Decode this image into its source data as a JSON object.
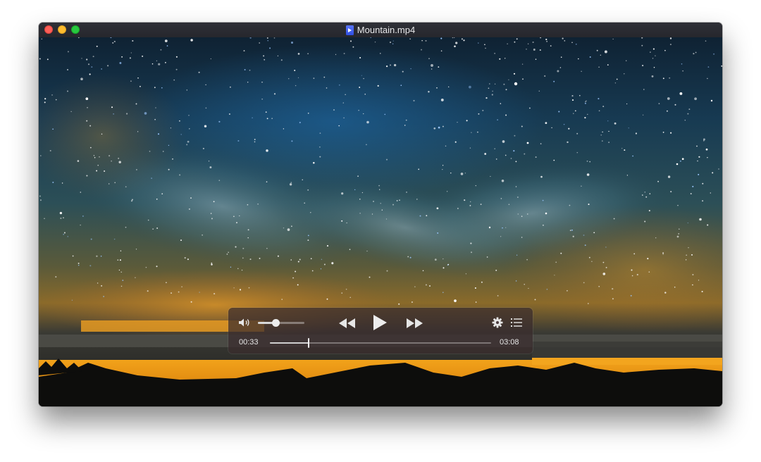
{
  "window": {
    "title": "Mountain.mp4",
    "file_icon": "video-file-icon"
  },
  "player": {
    "elapsed": "00:33",
    "duration": "03:08",
    "progress_fraction": 0.175,
    "volume_fraction": 0.38,
    "state": "paused"
  },
  "controls": {
    "volume_icon": "speaker-icon",
    "rewind_icon": "rewind-icon",
    "play_icon": "play-icon",
    "forward_icon": "fast-forward-icon",
    "settings_icon": "gear-icon",
    "chapters_icon": "list-icon"
  },
  "colors": {
    "close": "#fe5f57",
    "minimize": "#febc2e",
    "maximize": "#28c840"
  }
}
